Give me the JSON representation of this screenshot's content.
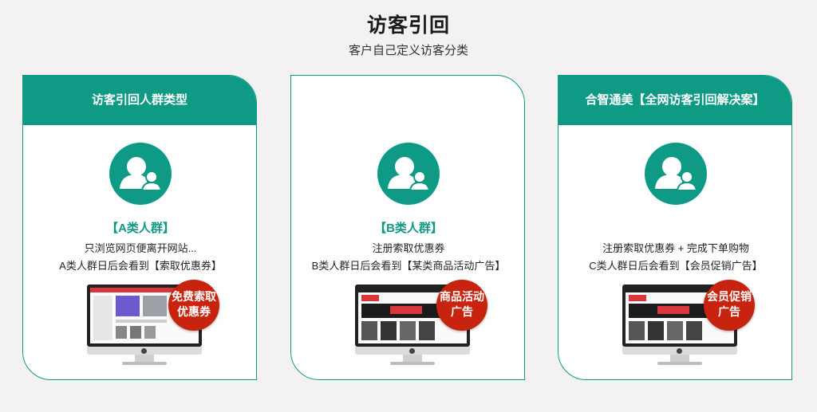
{
  "header": {
    "title": "访客引回",
    "subtitle": "客户自己定义访客分类"
  },
  "colors": {
    "accent": "#0f9a86",
    "badge": "#c8230f",
    "background": "#f3f1f2"
  },
  "cards": [
    {
      "head": "访客引回人群类型",
      "icon": "user-group-icon",
      "group": "【A类人群】",
      "line1": "只浏览网页便离开网站...",
      "line2": "A类人群日后会看到【索取优惠券】",
      "badge_line1": "免费索取",
      "badge_line2": "优惠券"
    },
    {
      "head": "",
      "icon": "user-group-icon",
      "group": "【B类人群】",
      "line1": "注册索取优惠券",
      "line2": "B类人群日后会看到【某类商品活动广告】",
      "badge_line1": "商品活动",
      "badge_line2": "广告"
    },
    {
      "head": "合智通美【全网访客引回解决案】",
      "icon": "user-group-icon",
      "group": "",
      "line1": "注册索取优惠券 + 完成下单购物",
      "line2": "C类人群日后会看到【会员促销广告】",
      "badge_line1": "会员促销",
      "badge_line2": "广告"
    }
  ]
}
